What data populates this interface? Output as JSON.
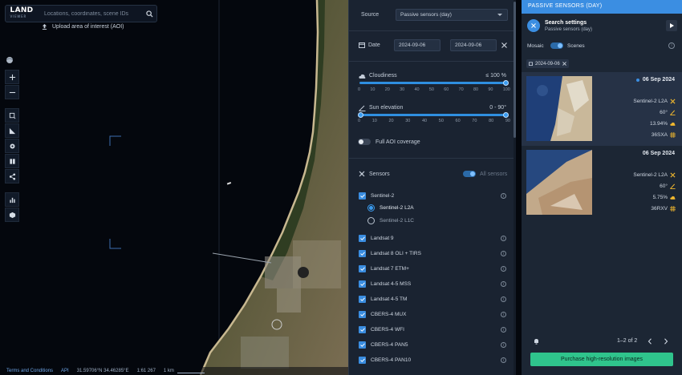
{
  "search": {
    "logo_main": "LAND",
    "logo_sub": "VIEWER",
    "placeholder": "Locations, coordinates, scene IDs",
    "upload_label": "Upload area of interest (AOI)"
  },
  "status_bar": {
    "terms": "Terms and Conditions",
    "api": "API",
    "coordinates": "31.59706°N 34.46285°E",
    "scale_ratio": "1:61 267",
    "scale_distance": "1 km"
  },
  "filters": {
    "source_label": "Source",
    "source_value": "Passive sensors (day)",
    "date_label": "Date",
    "date_from": "2024-09-06",
    "date_to": "2024-09-06",
    "cloudiness_label": "Cloudiness",
    "cloudiness_value": "≤ 100 %",
    "cloudiness_fraction": 1.0,
    "sun_label": "Sun elevation",
    "sun_value": "0 - 90°",
    "sun_range": [
      0,
      90
    ],
    "ticks": [
      "0",
      "10",
      "20",
      "30",
      "40",
      "50",
      "60",
      "70",
      "80",
      "90",
      "100"
    ],
    "sun_ticks": [
      "0",
      "10",
      "20",
      "30",
      "40",
      "50",
      "60",
      "70",
      "80",
      "90"
    ],
    "full_aoi_label": "Full AOI coverage",
    "sensors_label": "Sensors",
    "all_sensors_label": "All sensors",
    "sensors": [
      {
        "label": "Sentinel-2",
        "checked": true
      },
      {
        "label": "Sentinel-2 L2A",
        "radio": true,
        "selected": true
      },
      {
        "label": "Sentinel-2 L1C",
        "radio": true,
        "selected": false
      },
      {
        "label": "Landsat 9",
        "checked": true
      },
      {
        "label": "Landsat 8 OLI + TIRS",
        "checked": true
      },
      {
        "label": "Landsat 7 ETM+",
        "checked": true
      },
      {
        "label": "Landsat 4-5 MSS",
        "checked": true
      },
      {
        "label": "Landsat 4-5 TM",
        "checked": true
      },
      {
        "label": "CBERS-4 MUX",
        "checked": true
      },
      {
        "label": "CBERS-4 WFI",
        "checked": true
      },
      {
        "label": "CBERS-4 PAN5",
        "checked": true
      },
      {
        "label": "CBERS-4 PAN10",
        "checked": true
      }
    ]
  },
  "results": {
    "header": "PASSIVE SENSORS (DAY)",
    "settings_title": "Search settings",
    "settings_sub": "Passive sensors (day)",
    "mosaic_label": "Mosaic",
    "scenes_label": "Scenes",
    "date_chip": "2024-09-06",
    "cards": [
      {
        "date": "06 Sep 2024",
        "sensor": "Sentinel-2  L2A",
        "sun": "60°",
        "cloud": "13.94%",
        "tile": "36SXA"
      },
      {
        "date": "06 Sep 2024",
        "sensor": "Sentinel-2  L2A",
        "sun": "60°",
        "cloud": "5.75%",
        "tile": "36RXV"
      }
    ],
    "pager_text": "1–2 of 2",
    "purchase_label": "Purchase high-resolution images"
  },
  "colors": {
    "accent": "#3b8ee2",
    "purchase": "#2fc48c",
    "panel": "#1a2331"
  }
}
